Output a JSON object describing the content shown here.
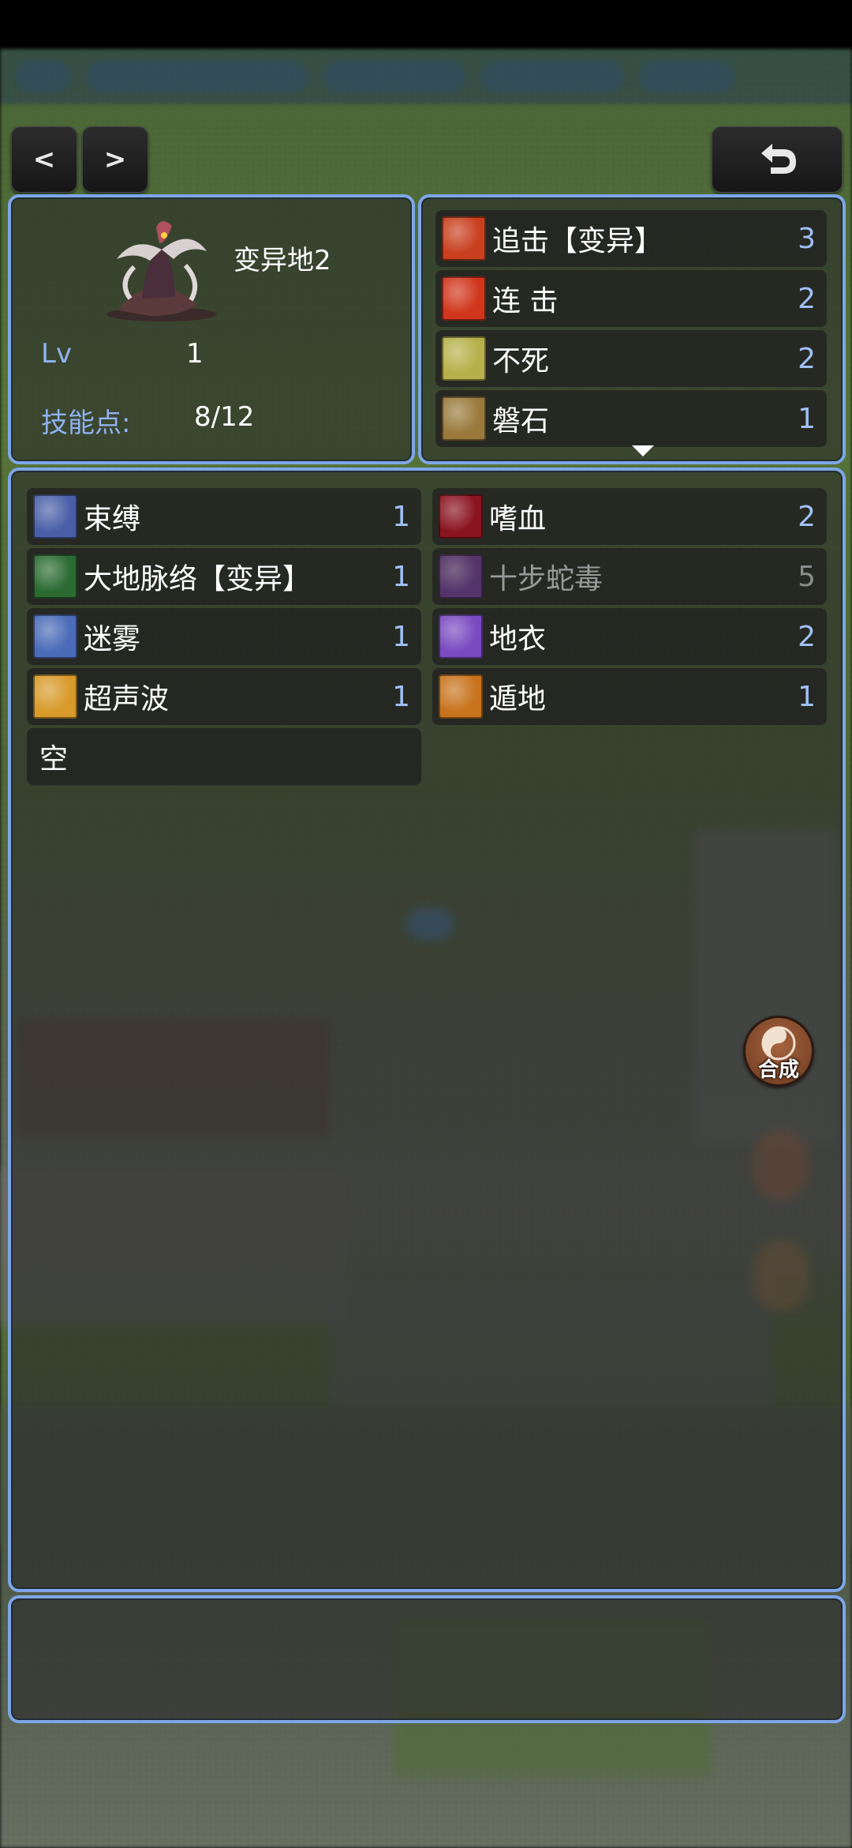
{
  "nav": {
    "prev_label": "<",
    "next_label": ">",
    "back_icon": "return-arrow-icon"
  },
  "monster": {
    "name": "变异地2",
    "lv_label": "Lv",
    "lv_value": "1",
    "skill_points_label": "技能点:",
    "skill_points_value": "8/12"
  },
  "equipped_skills": [
    {
      "name": "追击【变异】",
      "level": "3",
      "icon": "claw-strike-icon",
      "color": "#c8401e"
    },
    {
      "name": "连 击",
      "level": "2",
      "icon": "triple-spike-icon",
      "color": "#d0361c"
    },
    {
      "name": "不死",
      "level": "2",
      "icon": "gold-shield-icon",
      "color": "#b6b04a"
    },
    {
      "name": "磐石",
      "level": "1",
      "icon": "rock-spikes-icon",
      "color": "#9a7a3c"
    }
  ],
  "available_skills": {
    "left": [
      {
        "name": "束缚",
        "level": "1",
        "icon": "binding-chain-icon",
        "color": "#4a5fa8"
      },
      {
        "name": "大地脉络【变异】",
        "level": "1",
        "icon": "earth-vein-icon",
        "color": "#2b6b32"
      },
      {
        "name": "迷雾",
        "level": "1",
        "icon": "mist-icon",
        "color": "#4a6bb8"
      },
      {
        "name": "超声波",
        "level": "1",
        "icon": "sonic-wave-icon",
        "color": "#d89a2a"
      },
      {
        "name": "空",
        "level": "",
        "icon": "",
        "color": ""
      }
    ],
    "right": [
      {
        "name": "嗜血",
        "level": "2",
        "icon": "bloodthirst-icon",
        "color": "#8a1420",
        "dim": false
      },
      {
        "name": "十步蛇毒",
        "level": "5",
        "icon": "snake-venom-icon",
        "color": "#6a3a8a",
        "dim": true
      },
      {
        "name": "地衣",
        "level": "2",
        "icon": "lichen-icon",
        "color": "#7a4ac0",
        "dim": false
      },
      {
        "name": "遁地",
        "level": "1",
        "icon": "burrow-icon",
        "color": "#c8741e",
        "dim": false
      }
    ]
  },
  "side": {
    "synth_label": "合成"
  },
  "colors": {
    "panel_border": "#7ea6e6",
    "level_text": "#9fc0f7",
    "label_text": "#8fb2f2"
  }
}
